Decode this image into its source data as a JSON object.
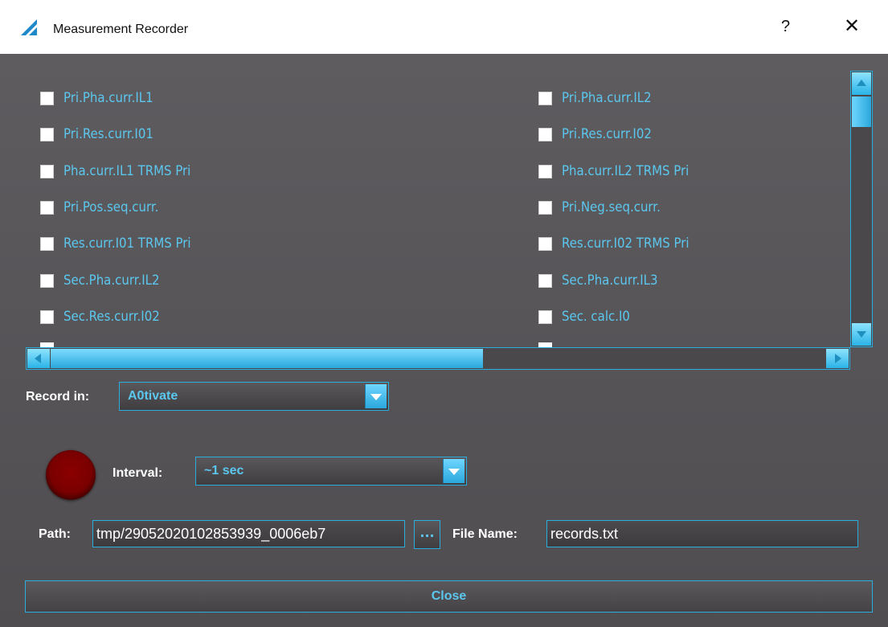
{
  "window": {
    "title": "Measurement Recorder",
    "help_label": "?",
    "close_label": "✕"
  },
  "measurements": {
    "left": [
      {
        "label": "Pri.Pha.curr.IL1",
        "checked": false
      },
      {
        "label": "Pri.Res.curr.I01",
        "checked": false
      },
      {
        "label": "Pha.curr.IL1 TRMS Pri",
        "checked": false
      },
      {
        "label": "Pri.Pos.seq.curr.",
        "checked": false
      },
      {
        "label": "Res.curr.I01 TRMS Pri",
        "checked": false
      },
      {
        "label": "Sec.Pha.curr.IL2",
        "checked": false
      },
      {
        "label": "Sec.Res.curr.I02",
        "checked": false
      }
    ],
    "right": [
      {
        "label": "Pri.Pha.curr.IL2",
        "checked": false
      },
      {
        "label": "Pri.Res.curr.I02",
        "checked": false
      },
      {
        "label": "Pha.curr.IL2 TRMS Pri",
        "checked": false
      },
      {
        "label": "Pri.Neg.seq.curr.",
        "checked": false
      },
      {
        "label": "Res.curr.I02 TRMS Pri",
        "checked": false
      },
      {
        "label": "Sec.Pha.curr.IL3",
        "checked": false
      },
      {
        "label": "Sec. calc.I0",
        "checked": false
      }
    ]
  },
  "record_in": {
    "label": "Record in:",
    "value": "A0tivate"
  },
  "interval": {
    "label": "Interval:",
    "value": "~1 sec"
  },
  "path": {
    "label": "Path:",
    "value": "tmp/29052020102853939_0006eb7",
    "browse_label": "..."
  },
  "file_name": {
    "label": "File Name:",
    "value": "records.txt"
  },
  "close_button": {
    "label": "Close"
  },
  "colors": {
    "accent": "#2aaee0",
    "label_text": "#5bc7ef",
    "background": "#59575a",
    "record": "#8b0000"
  }
}
